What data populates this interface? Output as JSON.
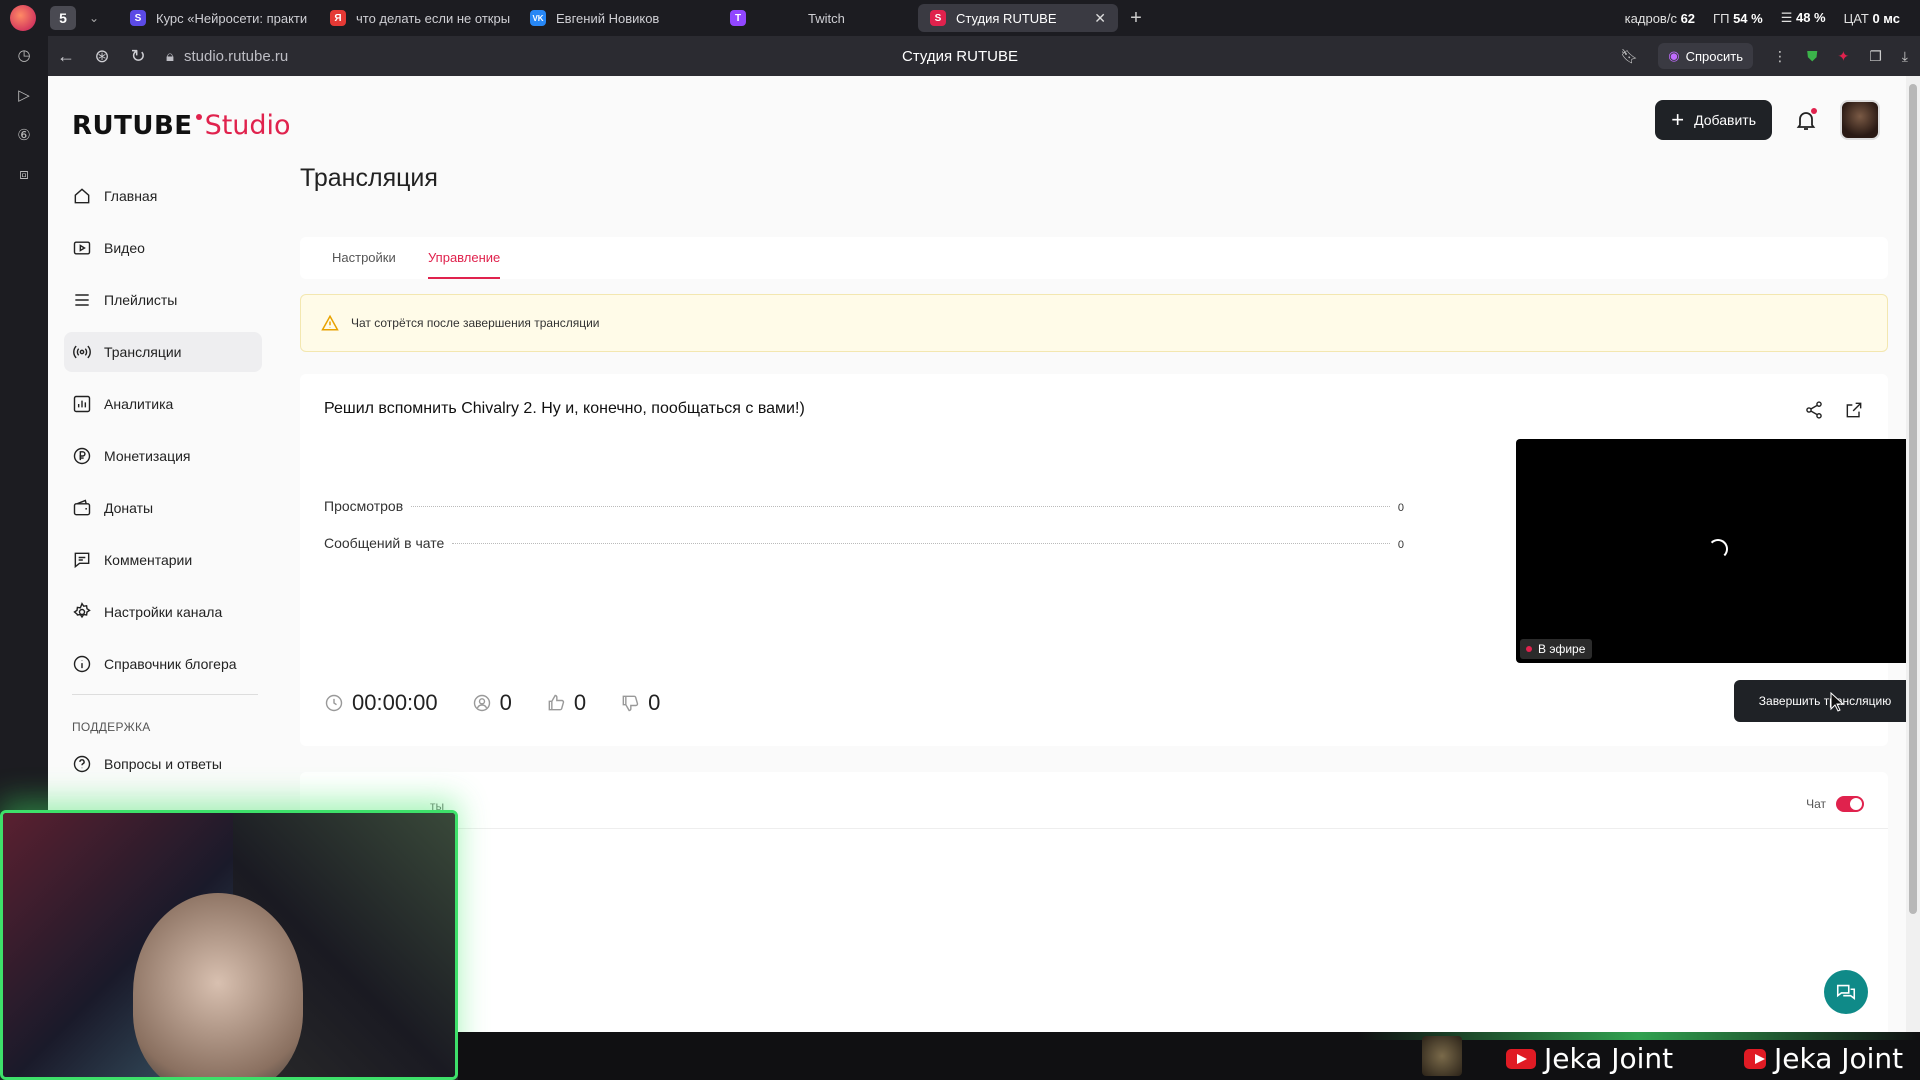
{
  "browser": {
    "tab_count": "5",
    "tabs": [
      {
        "label": "Курс «Нейросети: практи",
        "color": "#5b4ae6",
        "glyph": "S"
      },
      {
        "label": "что делать если не откры",
        "color": "#e53935",
        "glyph": "Я"
      },
      {
        "label": "Евгений Новиков",
        "color": "#2787f5",
        "glyph": "VK"
      },
      {
        "label": "Twitch",
        "color": "#9146ff",
        "glyph": "T"
      },
      {
        "label": "Студия RUTUBE",
        "color": "#e0224d",
        "glyph": "S"
      }
    ],
    "stats": {
      "fps_label": "кадров/с",
      "fps_value": "62",
      "gpu_label": "ГП",
      "gpu_value": "54 %",
      "cpu_value": "48 %",
      "lat_label": "ЦАТ",
      "lat_value": "0 мс"
    },
    "url": "studio.rutube.ru",
    "window_title": "Студия RUTUBE",
    "ask_label": "Спросить"
  },
  "brand": {
    "rutube": "RUTUBE",
    "studio": "Studio",
    "accent": "#e0224d"
  },
  "header": {
    "add_label": "Добавить"
  },
  "nav": {
    "items": [
      {
        "label": "Главная",
        "icon": "home-icon"
      },
      {
        "label": "Видео",
        "icon": "video-icon"
      },
      {
        "label": "Плейлисты",
        "icon": "playlist-icon"
      },
      {
        "label": "Трансляции",
        "icon": "broadcast-icon"
      },
      {
        "label": "Аналитика",
        "icon": "analytics-icon"
      },
      {
        "label": "Монетизация",
        "icon": "ruble-icon"
      },
      {
        "label": "Донаты",
        "icon": "wallet-icon"
      },
      {
        "label": "Комментарии",
        "icon": "comment-icon"
      },
      {
        "label": "Настройки канала",
        "icon": "gear-icon"
      },
      {
        "label": "Справочник блогера",
        "icon": "info-icon"
      }
    ],
    "support_label": "ПОДДЕРЖКА",
    "faq_label": "Вопросы и ответы"
  },
  "main": {
    "title": "Трансляция",
    "tabs": [
      {
        "label": "Настройки"
      },
      {
        "label": "Управление"
      }
    ],
    "notice": "Чат сотрётся после завершения трансляции",
    "stream": {
      "title": "Решил вспомнить Chivalry 2. Ну и, конечно, пообщаться с вами!)",
      "views_label": "Просмотров",
      "views_value": "0",
      "messages_label": "Сообщений в чате",
      "messages_value": "0",
      "duration": "00:00:00",
      "viewers": "0",
      "likes": "0",
      "dislikes": "0",
      "live_label": "В эфире",
      "end_label": "Завершить трансляцию"
    },
    "chat": {
      "tab_fragment": "ты",
      "toggle_label": "Чат",
      "toggle_on": true
    }
  },
  "overlay": {
    "streamer_name_1": "Jeka Joint",
    "streamer_name_2": "Jeka Joint"
  }
}
